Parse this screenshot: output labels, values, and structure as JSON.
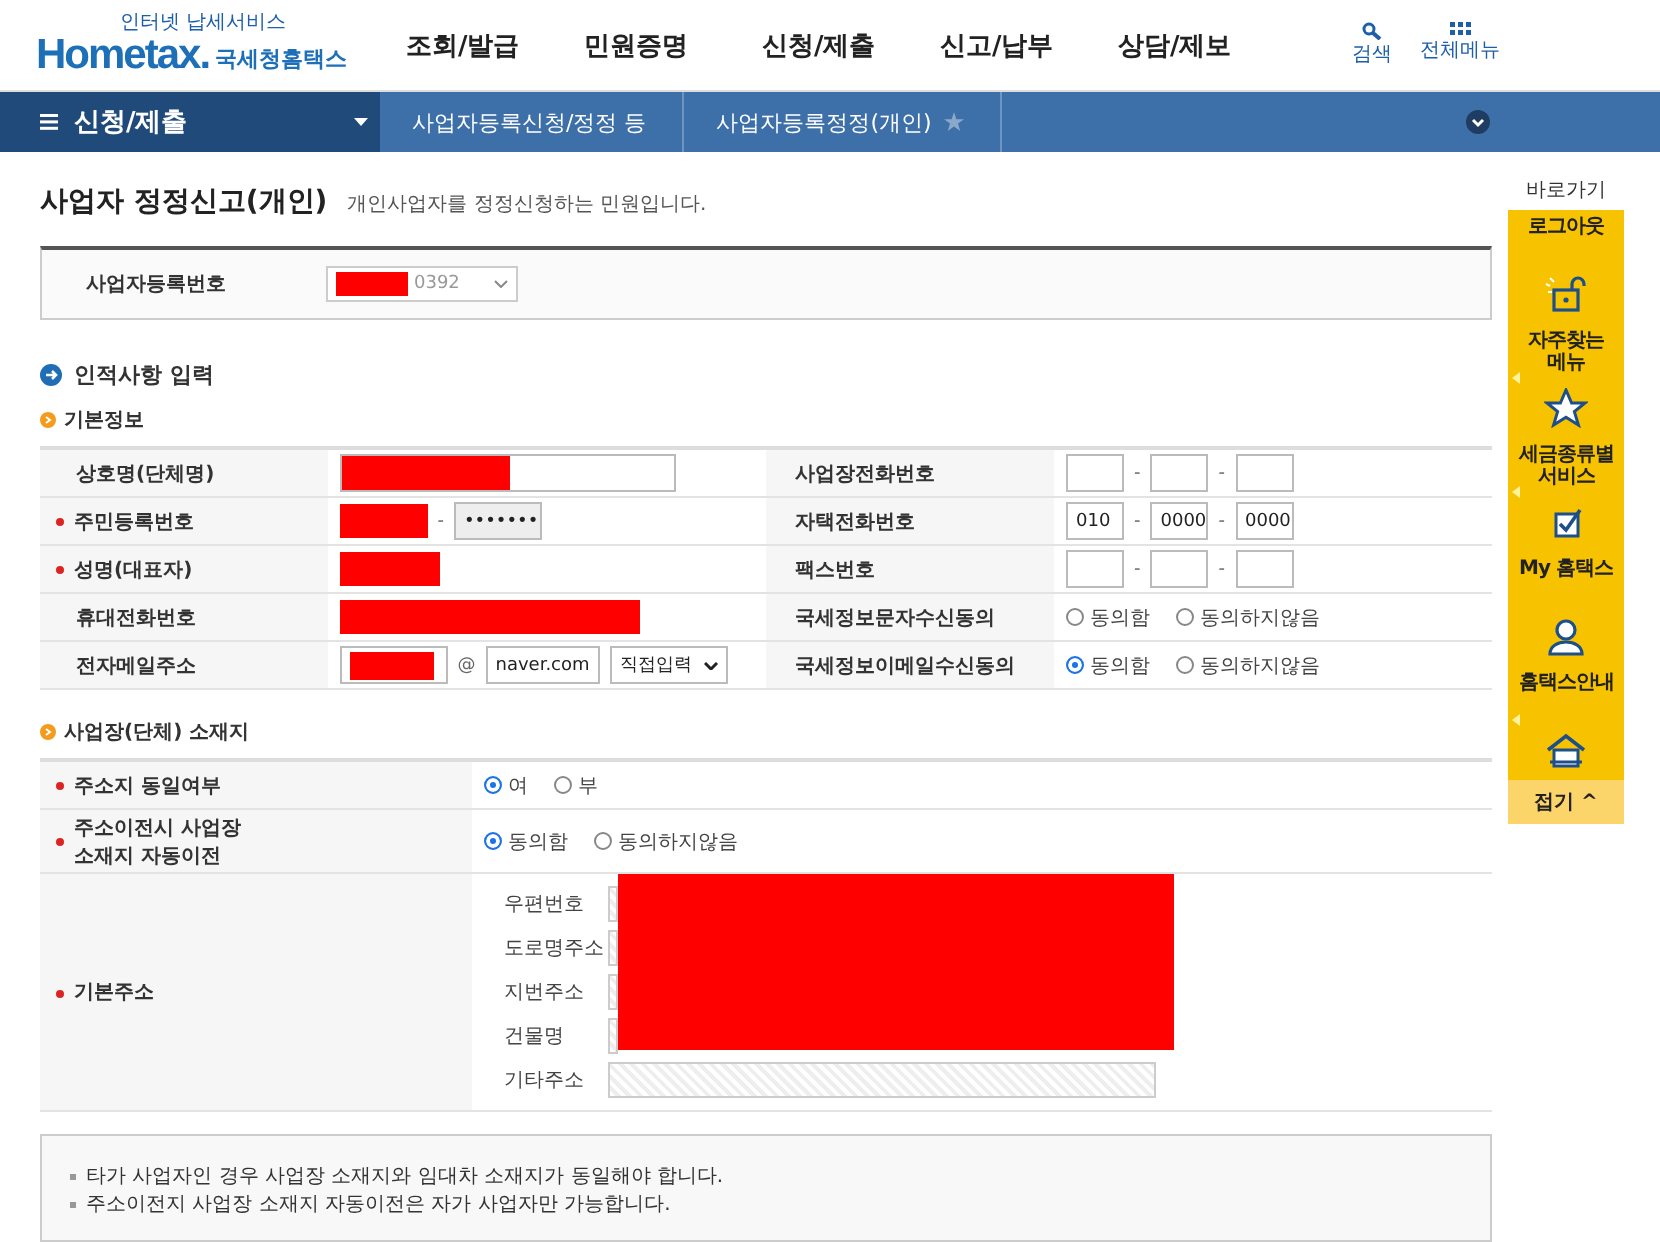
{
  "header": {
    "logo": {
      "tagline": "인터넷 납세서비스",
      "brand": "Hometax.",
      "name": "국세청홈택스"
    },
    "menu": [
      "조회/발급",
      "민원증명",
      "신청/제출",
      "신고/납부",
      "상담/제보"
    ],
    "tools": [
      {
        "kind": "search",
        "label": "검색"
      },
      {
        "kind": "grid",
        "label": "전체메뉴"
      }
    ]
  },
  "breadcrumb": {
    "menu": "신청/제출",
    "items": [
      {
        "label": "사업자등록신청/정정 등",
        "starred": false
      },
      {
        "label": "사업자등록정정(개인)",
        "starred": true
      }
    ]
  },
  "page": {
    "title": "사업자 정정신고(개인)",
    "description": "개인사업자를 정정신청하는 민원입니다."
  },
  "business_number": {
    "label": "사업자등록번호",
    "value": "0392",
    "redacted": true
  },
  "section": "인적사항 입력",
  "basic_info": {
    "title": "기본정보",
    "rows": [
      {
        "left": {
          "label": "상호명(단체명)",
          "required": false,
          "kind": "text",
          "redacted": true
        },
        "right": {
          "label": "사업장전화번호",
          "kind": "phone",
          "separators": [
            "-",
            "-"
          ]
        }
      },
      {
        "left": {
          "label": "주민등록번호",
          "required": true,
          "kind": "resident",
          "redacted": true,
          "separator": "-",
          "masked": "•••••••"
        },
        "right": {
          "label": "자택전화번호",
          "kind": "phone",
          "values": [
            "010",
            "0000",
            "0000"
          ],
          "separators": [
            "-",
            "-"
          ]
        }
      },
      {
        "left": {
          "label": "성명(대표자)",
          "required": true,
          "kind": "name",
          "redacted": true
        },
        "right": {
          "label": "팩스번호",
          "kind": "phone",
          "separators": [
            "-",
            "-"
          ]
        }
      },
      {
        "left": {
          "label": "휴대전화번호",
          "required": false,
          "kind": "mobile",
          "redacted": true
        },
        "right": {
          "label": "국세정보문자수신동의",
          "kind": "radio",
          "options": [
            {
              "label": "동의함",
              "selected": false
            },
            {
              "label": "동의하지않음",
              "selected": false
            }
          ]
        }
      },
      {
        "left": {
          "label": "전자메일주소",
          "required": false,
          "kind": "email",
          "redacted": true,
          "at": "@",
          "domain": "naver.com",
          "domain_select": "직접입력"
        },
        "right": {
          "label": "국세정보이메일수신동의",
          "kind": "radio",
          "options": [
            {
              "label": "동의함",
              "selected": true
            },
            {
              "label": "동의하지않음",
              "selected": false
            }
          ]
        }
      }
    ]
  },
  "location": {
    "title": "사업장(단체) 소재지",
    "rows": [
      {
        "label": "주소지 동일여부",
        "required": true,
        "kind": "radio",
        "options": [
          {
            "label": "여",
            "selected": true
          },
          {
            "label": "부",
            "selected": false
          }
        ]
      },
      {
        "label": "주소이전시 사업장\n소재지 자동이전",
        "required": true,
        "kind": "radio",
        "options": [
          {
            "label": "동의함",
            "selected": true
          },
          {
            "label": "동의하지않음",
            "selected": false
          }
        ]
      },
      {
        "label": "기본주소",
        "required": true,
        "kind": "address",
        "redacted": true,
        "fields": [
          "우편번호",
          "도로명주소",
          "지번주소",
          "건물명",
          "기타주소"
        ]
      }
    ]
  },
  "notes": [
    "타가 사업자인 경우 사업장 소재지와 임대차 소재지가 동일해야 합니다.",
    "주소이전지 사업장 소재지 자동이전은 자가 사업자만 가능합니다."
  ],
  "quick_menu": {
    "title": "바로가기",
    "items": [
      {
        "label": "로그아웃",
        "submenu": false
      },
      {
        "label": "자주찾는\n메뉴",
        "submenu": true
      },
      {
        "label": "세금종류별\n서비스",
        "submenu": true
      },
      {
        "label": "My 홈택스",
        "submenu": false
      },
      {
        "label": "홈택스안내",
        "submenu": true
      }
    ],
    "collapse": "접기",
    "collapse_glyph": "^"
  }
}
